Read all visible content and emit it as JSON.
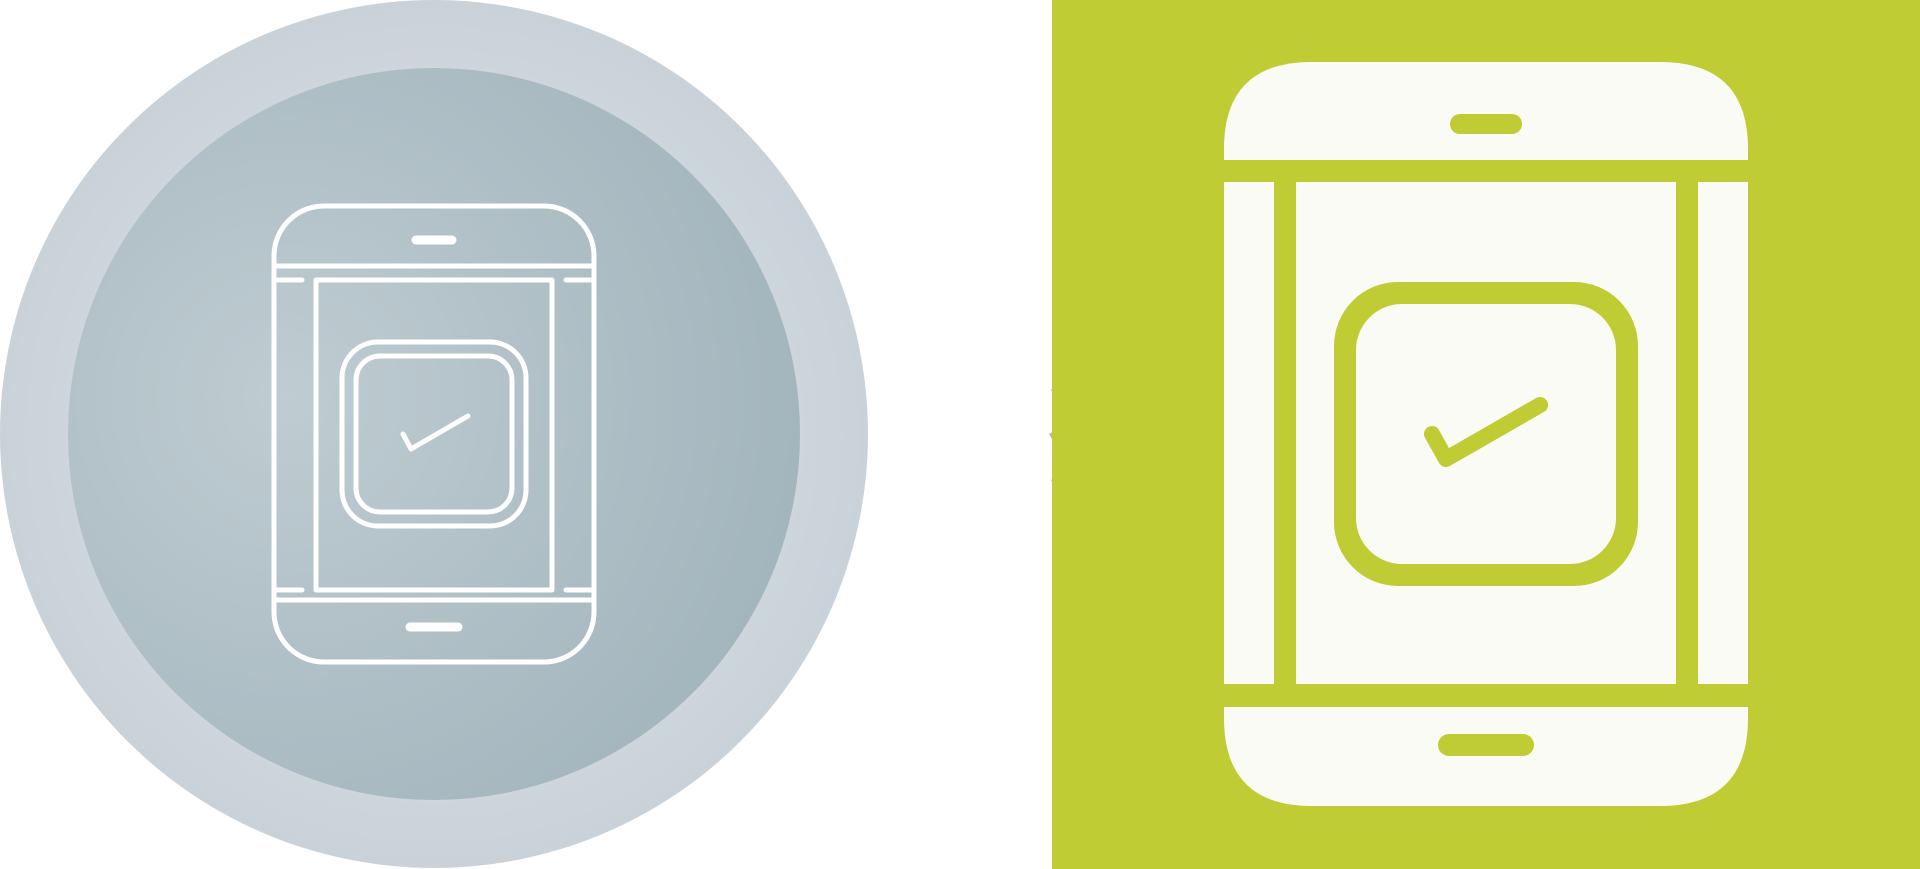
{
  "colors": {
    "background": "#ffffff",
    "outer_circle_edge": "#cbd3da",
    "outer_circle_center": "#dbe2e7",
    "inner_circle_center": "#bcc9cf",
    "inner_circle_edge": "#a6b8bf",
    "outline_icon_stroke": "#ffffff",
    "accent_panel": "#bfcc33",
    "glyph_fill": "#fbfbf5"
  },
  "icons": {
    "left": "mobile-checkbox-outline-icon",
    "right": "mobile-checkbox-glyph-icon"
  }
}
